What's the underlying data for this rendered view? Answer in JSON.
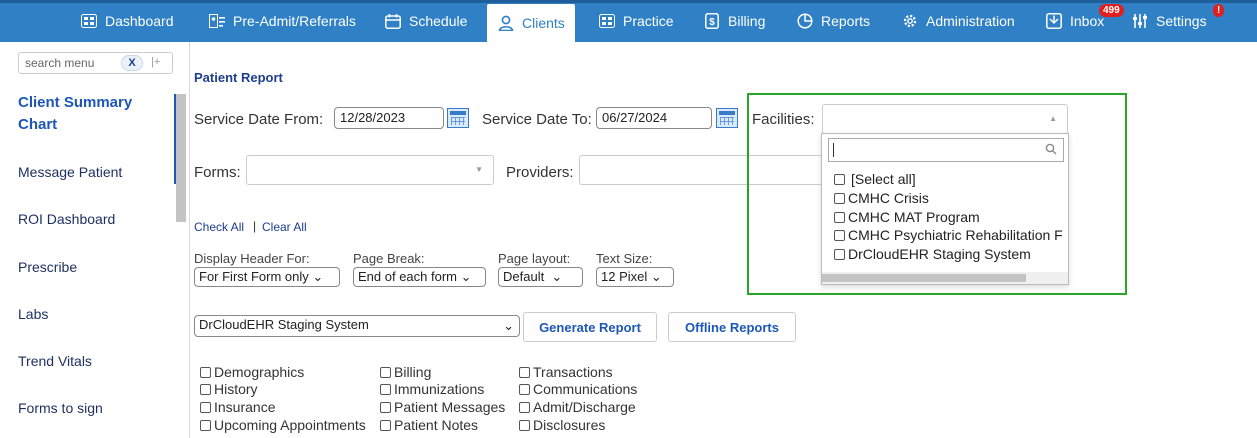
{
  "nav": {
    "items": [
      {
        "label": "Dashboard",
        "icon": "dashboard-icon"
      },
      {
        "label": "Pre-Admit/Referrals",
        "icon": "referrals-icon"
      },
      {
        "label": "Schedule",
        "icon": "calendar-icon"
      },
      {
        "label": "Clients",
        "icon": "user-icon",
        "active": true
      },
      {
        "label": "Practice",
        "icon": "practice-icon"
      },
      {
        "label": "Billing",
        "icon": "billing-icon"
      },
      {
        "label": "Reports",
        "icon": "pie-chart-icon"
      },
      {
        "label": "Administration",
        "icon": "gear-icon"
      },
      {
        "label": "Inbox",
        "icon": "inbox-icon",
        "badge": "499"
      },
      {
        "label": "Settings",
        "icon": "sliders-icon",
        "badge": "!"
      }
    ],
    "bg_color": "#2f80c4"
  },
  "sidebar": {
    "search_placeholder": "search menu",
    "clear_label": "X",
    "pin_label": "|+",
    "items": [
      {
        "label": "Client Summary Chart",
        "active": true
      },
      {
        "label": "Message Patient"
      },
      {
        "label": "ROI Dashboard"
      },
      {
        "label": "Prescribe"
      },
      {
        "label": "Labs"
      },
      {
        "label": "Trend Vitals"
      },
      {
        "label": "Forms to sign"
      }
    ]
  },
  "report": {
    "title": "Patient Report",
    "service_date_from_label": "Service Date From:",
    "service_date_from": "12/28/2023",
    "service_date_to_label": "Service Date To:",
    "service_date_to": "06/27/2024",
    "facilities_label": "Facilities:",
    "forms_label": "Forms:",
    "providers_label": "Providers:",
    "check_all": "Check All",
    "separator": "|",
    "clear_all": "Clear All",
    "display_header_label": "Display Header For:",
    "display_header_value": "For First Form only",
    "page_break_label": "Page Break:",
    "page_break_value": "End of each form",
    "page_layout_label": "Page layout:",
    "page_layout_value": "Default",
    "text_size_label": "Text Size:",
    "text_size_value": "12 Pixel",
    "facility_select_value": "DrCloudEHR Staging System",
    "generate_button": "Generate Report",
    "offline_button": "Offline Reports"
  },
  "facilities_dropdown": {
    "options": [
      "[Select all]",
      "CMHC Crisis",
      "CMHC MAT Program",
      "CMHC Psychiatric Rehabilitation F",
      "DrCloudEHR Staging System"
    ],
    "highlight_color": "#2aa52a"
  },
  "sections": [
    [
      "Demographics",
      "History",
      "Insurance",
      "Upcoming Appointments"
    ],
    [
      "Billing",
      "Immunizations",
      "Patient Messages",
      "Patient Notes"
    ],
    [
      "Transactions",
      "Communications",
      "Admit/Discharge",
      "Disclosures"
    ]
  ]
}
